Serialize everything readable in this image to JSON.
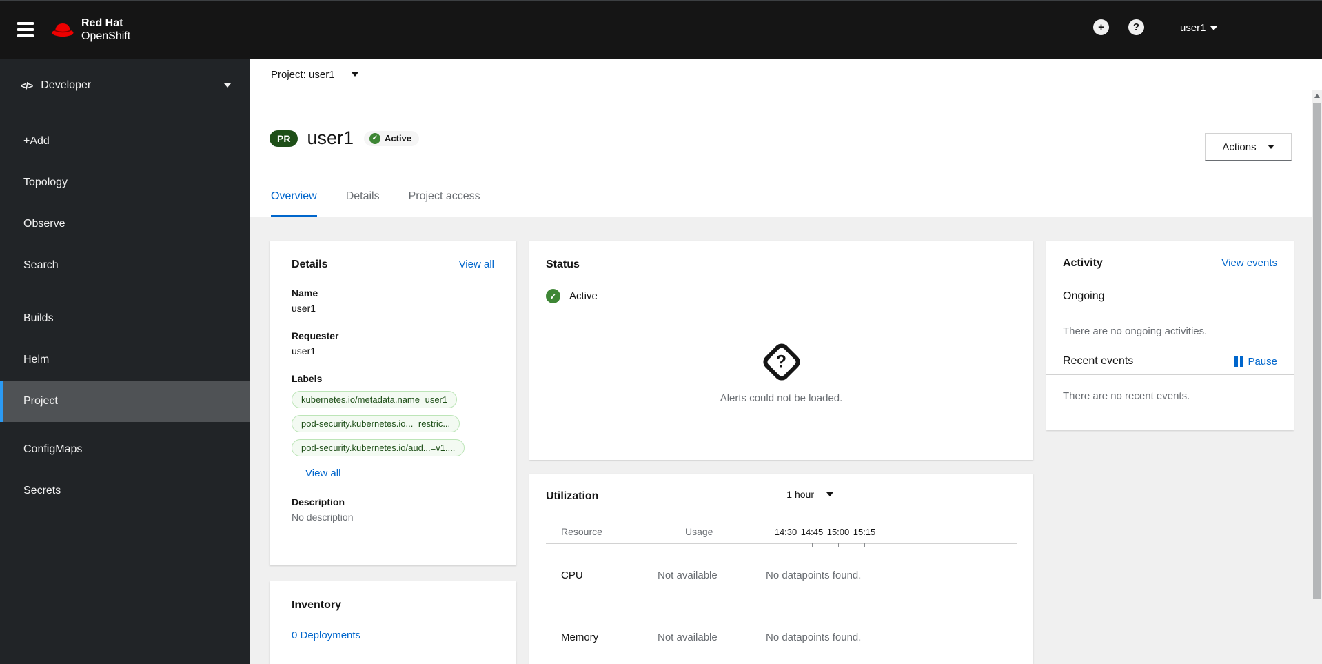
{
  "masthead": {
    "brand_top": "Red Hat",
    "brand_bottom": "OpenShift",
    "username": "user1"
  },
  "icons": {
    "code": "</>",
    "plus": "+",
    "question": "?",
    "check": "✓",
    "alert_question": "?"
  },
  "sidebar": {
    "perspective": "Developer",
    "items": [
      {
        "label": "+Add"
      },
      {
        "label": "Topology"
      },
      {
        "label": "Observe"
      },
      {
        "label": "Search"
      },
      {
        "label": "Builds"
      },
      {
        "label": "Helm"
      },
      {
        "label": "Project"
      },
      {
        "label": "ConfigMaps"
      },
      {
        "label": "Secrets"
      }
    ]
  },
  "project_bar": {
    "label": "Project: user1"
  },
  "page_header": {
    "badge": "PR",
    "title": "user1",
    "status": "Active",
    "actions": "Actions"
  },
  "tabs": [
    {
      "label": "Overview"
    },
    {
      "label": "Details"
    },
    {
      "label": "Project access"
    }
  ],
  "details_card": {
    "title": "Details",
    "view_all": "View all",
    "name_label": "Name",
    "name": "user1",
    "requester_label": "Requester",
    "requester": "user1",
    "labels_label": "Labels",
    "labels": [
      "kubernetes.io/metadata.name=user1",
      "pod-security.kubernetes.io...=restric...",
      "pod-security.kubernetes.io/aud...=v1...."
    ],
    "view_all_labels": "View all",
    "description_label": "Description",
    "description": "No description"
  },
  "inventory_card": {
    "title": "Inventory",
    "deployments_link": "0 Deployments"
  },
  "status_card": {
    "title": "Status",
    "status": "Active",
    "alerts_empty": "Alerts could not be loaded."
  },
  "utilization_card": {
    "title": "Utilization",
    "duration": "1 hour",
    "resource_col": "Resource",
    "usage_col": "Usage",
    "times": [
      "14:30",
      "14:45",
      "15:00",
      "15:15"
    ],
    "rows": [
      {
        "resource": "CPU",
        "usage": "Not available",
        "data": "No datapoints found."
      },
      {
        "resource": "Memory",
        "usage": "Not available",
        "data": "No datapoints found."
      }
    ]
  },
  "activity_card": {
    "title": "Activity",
    "view_events": "View events",
    "ongoing_label": "Ongoing",
    "ongoing_empty": "There are no ongoing activities.",
    "recent_label": "Recent events",
    "pause_label": "Pause",
    "recent_empty": "There are no recent events."
  },
  "colors": {
    "masthead_bg": "#151515",
    "sidebar_bg": "#212427",
    "sidebar_active_bg": "#4f5255",
    "active_indicator_blue": "#2b9af3",
    "link_blue": "#0066cc",
    "status_green": "#3e8635",
    "project_badge_green": "#1e4f18",
    "label_green_bg": "#f3faf2",
    "label_green_border": "#bde5b8",
    "content_bg": "#f0f0f0"
  }
}
